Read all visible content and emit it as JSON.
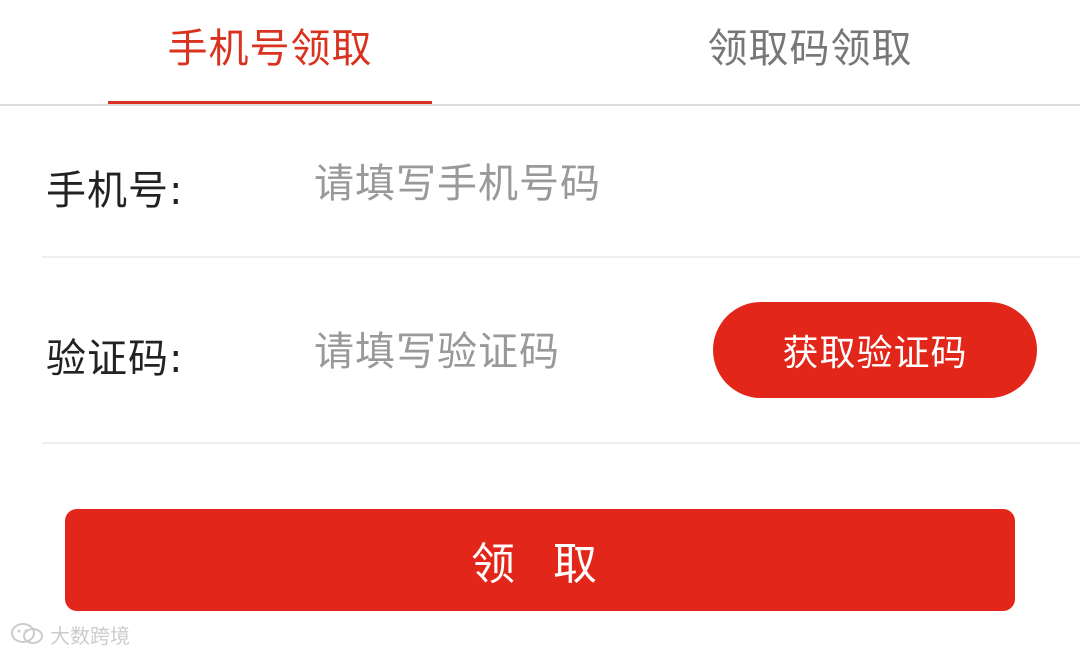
{
  "tabs": [
    {
      "label": "手机号领取",
      "active": true
    },
    {
      "label": "领取码领取",
      "active": false
    }
  ],
  "form": {
    "phone": {
      "label": "手机号:",
      "placeholder": "请填写手机号码",
      "value": ""
    },
    "code": {
      "label": "验证码:",
      "placeholder": "请填写验证码",
      "value": "",
      "get_code_button": "获取验证码"
    }
  },
  "submit_label": "领 取",
  "watermark": {
    "text": "大数跨境",
    "icon": "wechat-logo-icon"
  },
  "colors": {
    "accent": "#e2261a",
    "tab_active": "#d9321f",
    "tab_inactive": "#777777",
    "placeholder": "#999999",
    "divider": "#eeeeee"
  }
}
